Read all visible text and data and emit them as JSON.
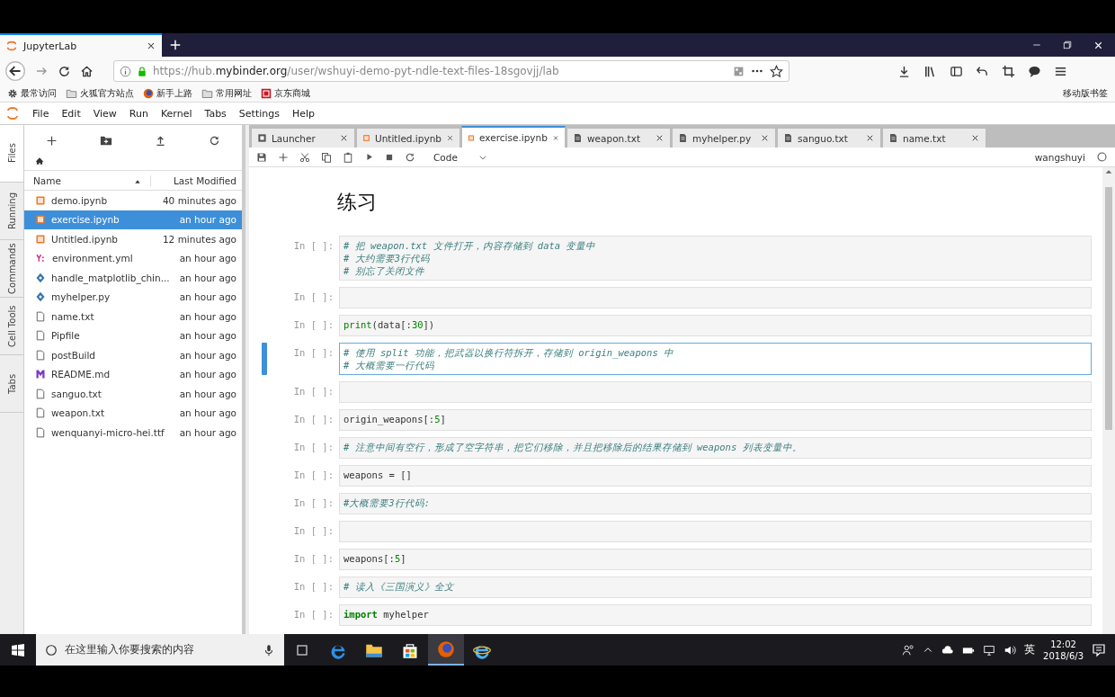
{
  "browser": {
    "tab_title": "JupyterLab",
    "url": "https://hub.**mybinder.org**/user/wshuyi-demo-pyt-ndle-text-files-18sgovjj/lab",
    "bookmarks": [
      {
        "label": "最常访问",
        "kind": "gear"
      },
      {
        "label": "火狐官方站点",
        "kind": "folder"
      },
      {
        "label": "新手上路",
        "kind": "firefox"
      },
      {
        "label": "常用网址",
        "kind": "folder"
      },
      {
        "label": "京东商城",
        "kind": "jd"
      }
    ],
    "bookmarks_end": "移动版书签"
  },
  "menu": [
    "File",
    "Edit",
    "View",
    "Run",
    "Kernel",
    "Tabs",
    "Settings",
    "Help"
  ],
  "side_tabs": [
    {
      "label": "Files",
      "selected": true
    },
    {
      "label": "Running",
      "selected": false
    },
    {
      "label": "Commands",
      "selected": false
    },
    {
      "label": "Cell Tools",
      "selected": false
    },
    {
      "label": "Tabs",
      "selected": false
    }
  ],
  "file_browser": {
    "name_column": "Name",
    "modified_column": "Last Modified",
    "files": [
      {
        "name": "demo.ipynb",
        "modified": "40 minutes ago",
        "kind": "notebook",
        "selected": false
      },
      {
        "name": "exercise.ipynb",
        "modified": "an hour ago",
        "kind": "notebook",
        "selected": true
      },
      {
        "name": "Untitled.ipynb",
        "modified": "12 minutes ago",
        "kind": "notebook",
        "selected": false
      },
      {
        "name": "environment.yml",
        "modified": "an hour ago",
        "kind": "yaml",
        "selected": false
      },
      {
        "name": "handle_matplotlib_chin...",
        "modified": "an hour ago",
        "kind": "python",
        "selected": false
      },
      {
        "name": "myhelper.py",
        "modified": "an hour ago",
        "kind": "python",
        "selected": false
      },
      {
        "name": "name.txt",
        "modified": "an hour ago",
        "kind": "file",
        "selected": false
      },
      {
        "name": "Pipfile",
        "modified": "an hour ago",
        "kind": "file",
        "selected": false
      },
      {
        "name": "postBuild",
        "modified": "an hour ago",
        "kind": "file",
        "selected": false
      },
      {
        "name": "README.md",
        "modified": "an hour ago",
        "kind": "markdown",
        "selected": false
      },
      {
        "name": "sanguo.txt",
        "modified": "an hour ago",
        "kind": "file",
        "selected": false
      },
      {
        "name": "weapon.txt",
        "modified": "an hour ago",
        "kind": "file",
        "selected": false
      },
      {
        "name": "wenquanyi-micro-hei.ttf",
        "modified": "an hour ago",
        "kind": "file",
        "selected": false
      }
    ]
  },
  "doc_tabs": [
    {
      "label": "Launcher",
      "kind": "launcher",
      "selected": false
    },
    {
      "label": "Untitled.ipynb",
      "kind": "notebook",
      "selected": false
    },
    {
      "label": "exercise.ipynb",
      "kind": "notebook",
      "selected": true
    },
    {
      "label": "weapon.txt",
      "kind": "text",
      "selected": false
    },
    {
      "label": "myhelper.py",
      "kind": "text",
      "selected": false
    },
    {
      "label": "sanguo.txt",
      "kind": "text",
      "selected": false
    },
    {
      "label": "name.txt",
      "kind": "text",
      "selected": false
    }
  ],
  "notebook": {
    "cell_type": "Code",
    "user": "wangshuyi",
    "title": "练习",
    "cells": [
      {
        "prompt": "In [ ]:",
        "selected": false,
        "lines": [
          [
            {
              "text": "# 把 weapon.txt 文件打开，内容存储到 data 变量中",
              "kind": "comment"
            }
          ],
          [
            {
              "text": "# 大约需要3行代码",
              "kind": "comment"
            }
          ],
          [
            {
              "text": "# 别忘了关闭文件",
              "kind": "comment"
            }
          ]
        ]
      },
      {
        "prompt": "In [ ]:",
        "selected": false
      },
      {
        "prompt": "In [ ]:",
        "selected": false,
        "lines": [
          [
            {
              "text": "print",
              "kind": "builtin"
            },
            {
              "text": "(data[:",
              "kind": "plain"
            },
            {
              "text": "30",
              "kind": "number"
            },
            {
              "text": "])",
              "kind": "plain"
            }
          ]
        ]
      },
      {
        "prompt": "In [ ]:",
        "selected": true,
        "lines": [
          [
            {
              "text": "# 使用 split 功能，把武器以换行符拆开，存储到 origin_weapons 中",
              "kind": "comment"
            }
          ],
          [
            {
              "text": "# 大概需要一行代码",
              "kind": "comment"
            }
          ]
        ]
      },
      {
        "prompt": "In [ ]:",
        "selected": false
      },
      {
        "prompt": "In [ ]:",
        "selected": false,
        "lines": [
          [
            {
              "text": "origin_weapons[:",
              "kind": "plain"
            },
            {
              "text": "5",
              "kind": "number"
            },
            {
              "text": "]",
              "kind": "plain"
            }
          ]
        ]
      },
      {
        "prompt": "In [ ]:",
        "selected": false,
        "lines": [
          [
            {
              "text": "# 注意中间有空行，形成了空字符串，把它们移除，并且把移除后的结果存储到 weapons 列表变量中。",
              "kind": "comment"
            }
          ]
        ]
      },
      {
        "prompt": "In [ ]:",
        "selected": false,
        "lines": [
          [
            {
              "text": "weapons = []",
              "kind": "plain"
            }
          ]
        ]
      },
      {
        "prompt": "In [ ]:",
        "selected": false,
        "lines": [
          [
            {
              "text": "#大概需要3行代码:",
              "kind": "comment"
            }
          ]
        ]
      },
      {
        "prompt": "In [ ]:",
        "selected": false
      },
      {
        "prompt": "In [ ]:",
        "selected": false,
        "lines": [
          [
            {
              "text": "weapons[:",
              "kind": "plain"
            },
            {
              "text": "5",
              "kind": "number"
            },
            {
              "text": "]",
              "kind": "plain"
            }
          ]
        ]
      },
      {
        "prompt": "In [ ]:",
        "selected": false,
        "lines": [
          [
            {
              "text": "# 读入《三国演义》全文",
              "kind": "comment"
            }
          ]
        ]
      },
      {
        "prompt": "In [ ]:",
        "selected": false,
        "lines": [
          [
            {
              "text": "import",
              "kind": "keyword"
            },
            {
              "text": " myhelper",
              "kind": "plain"
            }
          ]
        ]
      }
    ]
  },
  "taskbar": {
    "search_placeholder": "在这里输入你要搜索的内容",
    "ime": "英",
    "time": "12:02",
    "date": "2018/6/3"
  }
}
